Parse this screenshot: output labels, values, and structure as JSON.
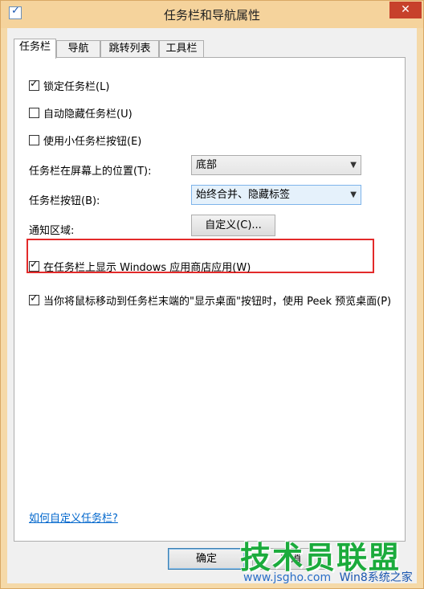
{
  "window": {
    "title": "任务栏和导航属性",
    "close_glyph": "✕"
  },
  "tabs": [
    {
      "label": "任务栏",
      "active": true
    },
    {
      "label": "导航"
    },
    {
      "label": "跳转列表"
    },
    {
      "label": "工具栏"
    }
  ],
  "options": {
    "lock_taskbar": {
      "label": "锁定任务栏(L)",
      "checked": true
    },
    "auto_hide": {
      "label": "自动隐藏任务栏(U)",
      "checked": false
    },
    "small_buttons": {
      "label": "使用小任务栏按钮(E)",
      "checked": false
    },
    "show_store_apps": {
      "label": "在任务栏上显示 Windows 应用商店应用(W)",
      "checked": true
    },
    "peek": {
      "label": "当你将鼠标移动到任务栏末端的\"显示桌面\"按钮时，使用 Peek 预览桌面(P)",
      "checked": true
    }
  },
  "position": {
    "label": "任务栏在屏幕上的位置(T):",
    "value": "底部"
  },
  "buttons_combine": {
    "label": "任务栏按钮(B):",
    "value": "始终合并、隐藏标签"
  },
  "notification_area": {
    "label": "通知区域:",
    "button": "自定义(C)..."
  },
  "help_link": "如何自定义任务栏?",
  "footer": {
    "ok": "确定",
    "cancel": "取消"
  },
  "watermark": {
    "main": "技术员联盟",
    "sub": "www.jsgho.com",
    "sub2": "Win8系统之家"
  },
  "colors": {
    "highlight": "#e32a2a",
    "link": "#0066cc",
    "close": "#c7412b"
  }
}
